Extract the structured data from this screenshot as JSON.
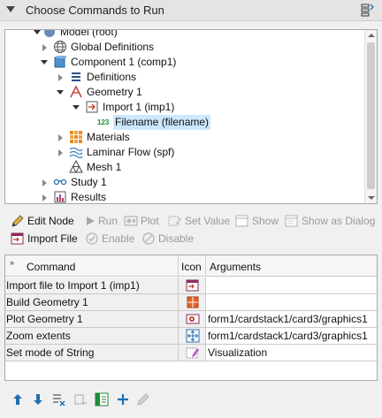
{
  "header": {
    "title": "Choose Commands to Run"
  },
  "tree": {
    "nodes": [
      {
        "label": "Model (root)"
      },
      {
        "label": "Global Definitions"
      },
      {
        "label": "Component 1 (comp1)"
      },
      {
        "label": "Definitions"
      },
      {
        "label": "Geometry 1"
      },
      {
        "label": "Import 1 (imp1)"
      },
      {
        "label": "Filename (filename)",
        "badge": "123"
      },
      {
        "label": "Materials"
      },
      {
        "label": "Laminar Flow (spf)"
      },
      {
        "label": "Mesh 1"
      },
      {
        "label": "Study 1"
      },
      {
        "label": "Results"
      }
    ]
  },
  "toolbar1": {
    "edit_node": "Edit Node",
    "run": "Run",
    "plot": "Plot",
    "set_value": "Set Value",
    "show": "Show",
    "show_as_dialog": "Show as Dialog"
  },
  "toolbar2": {
    "import_file": "Import File",
    "enable": "Enable",
    "disable": "Disable"
  },
  "command_table": {
    "corner": "»",
    "headers": [
      "Command",
      "Icon",
      "Arguments"
    ],
    "rows": [
      {
        "command": "Import file to Import 1 (imp1)",
        "icon": "import-file-icon",
        "arguments": ""
      },
      {
        "command": "Build Geometry 1",
        "icon": "build-geometry-icon",
        "arguments": ""
      },
      {
        "command": "Plot Geometry 1",
        "icon": "plot-icon",
        "arguments": "form1/cardstack1/card3/graphics1"
      },
      {
        "command": "Zoom extents",
        "icon": "zoom-extents-icon",
        "arguments": "form1/cardstack1/card3/graphics1"
      },
      {
        "command": "Set mode of String",
        "icon": "set-mode-icon",
        "arguments": "Visualization"
      }
    ]
  },
  "colors": {
    "selection": "#cce8ff",
    "accent_blue": "#1f6fb2",
    "geometry_red": "#c0392b",
    "materials_orange": "#e58b1f"
  }
}
